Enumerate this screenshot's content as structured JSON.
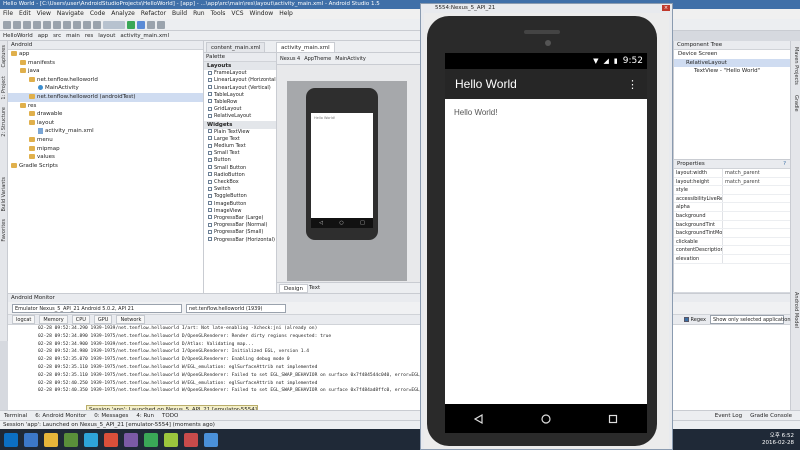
{
  "window": {
    "title": "Hello World - [C:\\Users\\user\\AndroidStudioProjects\\HelloWorld] - [app] - ...\\app\\src\\main\\res\\layout\\activity_main.xml - Android Studio 1.5"
  },
  "menu": [
    "File",
    "Edit",
    "View",
    "Navigate",
    "Code",
    "Analyze",
    "Refactor",
    "Build",
    "Run",
    "Tools",
    "VCS",
    "Window",
    "Help"
  ],
  "breadcrumbs": [
    "HelloWorld",
    "app",
    "src",
    "main",
    "res",
    "layout",
    "activity_main.xml"
  ],
  "left_strip": [
    "1: Project",
    "2: Structure",
    "Captures",
    "Build Variants",
    "Favorites"
  ],
  "project": {
    "selector": "Android",
    "tree": [
      {
        "label": "app",
        "kind": "folder",
        "indent": 0
      },
      {
        "label": "manifests",
        "kind": "folder",
        "indent": 1
      },
      {
        "label": "java",
        "kind": "folder",
        "indent": 1
      },
      {
        "label": "net.tenflow.helloworld",
        "kind": "folder",
        "indent": 2
      },
      {
        "label": "MainActivity",
        "kind": "class",
        "indent": 3
      },
      {
        "label": "net.tenflow.helloworld (androidTest)",
        "kind": "folder",
        "indent": 2
      },
      {
        "label": "res",
        "kind": "folder",
        "indent": 1
      },
      {
        "label": "drawable",
        "kind": "folder",
        "indent": 2
      },
      {
        "label": "layout",
        "kind": "folder",
        "indent": 2
      },
      {
        "label": "activity_main.xml",
        "kind": "file",
        "indent": 3
      },
      {
        "label": "menu",
        "kind": "folder",
        "indent": 2
      },
      {
        "label": "mipmap",
        "kind": "folder",
        "indent": 2
      },
      {
        "label": "values",
        "kind": "folder",
        "indent": 2
      },
      {
        "label": "Gradle Scripts",
        "kind": "folder",
        "indent": 0
      }
    ],
    "selected_index": 5
  },
  "editor_tabs": [
    "content_main.xml",
    "activity_main.xml"
  ],
  "palette": {
    "title": "Palette",
    "sections": [
      {
        "name": "Layouts",
        "items": [
          "FrameLayout",
          "LinearLayout (Horizontal)",
          "LinearLayout (Vertical)",
          "TableLayout",
          "TableRow",
          "GridLayout",
          "RelativeLayout"
        ]
      },
      {
        "name": "Widgets",
        "items": [
          "Plain TextView",
          "Large Text",
          "Medium Text",
          "Small Text",
          "Button",
          "Small Button",
          "RadioButton",
          "CheckBox",
          "Switch",
          "ToggleButton",
          "ImageButton",
          "ImageView",
          "ProgressBar (Large)",
          "ProgressBar (Normal)",
          "ProgressBar (Small)",
          "ProgressBar (Horizontal)"
        ]
      }
    ]
  },
  "designer": {
    "toolbar": [
      "Nexus 4",
      "AppTheme",
      "MainActivity"
    ],
    "preview_text": "Hello World!",
    "tabs": [
      "Design",
      "Text"
    ],
    "active_tab": "Design"
  },
  "emulator": {
    "title": "5554:Nexus_5_API_21",
    "time": "9:52",
    "app_title": "Hello World",
    "content": "Hello World!"
  },
  "component_tree": {
    "title": "Component Tree",
    "items": [
      "Device Screen",
      "RelativeLayout",
      "TextView - \"Hello World\""
    ]
  },
  "properties": {
    "title": "Properties",
    "rows": [
      {
        "k": "layout:width",
        "v": "match_parent"
      },
      {
        "k": "layout:height",
        "v": "match_parent"
      },
      {
        "k": "style",
        "v": ""
      },
      {
        "k": "accessibilityLiveRegion",
        "v": ""
      },
      {
        "k": "alpha",
        "v": ""
      },
      {
        "k": "background",
        "v": ""
      },
      {
        "k": "backgroundTint",
        "v": ""
      },
      {
        "k": "backgroundTintMode",
        "v": ""
      },
      {
        "k": "clickable",
        "v": ""
      },
      {
        "k": "contentDescription",
        "v": ""
      },
      {
        "k": "elevation",
        "v": ""
      }
    ]
  },
  "right_strip": [
    "Maven Projects",
    "Gradle",
    "Android Model"
  ],
  "monitor": {
    "title": "Android Monitor",
    "device": "Emulator Nexus_5_API_21  Android 5.0.2, API 21",
    "process": "net.tenflow.helloworld (1939)",
    "tabs": [
      "logcat",
      "Memory",
      "CPU",
      "GPU",
      "Network"
    ],
    "regex_label": "Regex",
    "filter": "Show only selected application",
    "log_lines": [
      "02-28 09:52:34.290 1939-1939/net.tenflow.helloworld I/art: Not late-enabling -Xcheck:jni (already on)",
      "02-28 09:52:34.890 1939-1975/net.tenflow.helloworld D/OpenGLRenderer: Render dirty regions requested: true",
      "02-28 09:52:34.900 1939-1939/net.tenflow.helloworld D/Atlas: Validating map...",
      "02-28 09:52:34.980 1939-1975/net.tenflow.helloworld I/OpenGLRenderer: Initialized EGL, version 1.4",
      "02-28 09:52:35.070 1939-1975/net.tenflow.helloworld D/OpenGLRenderer: Enabling debug mode 0",
      "02-28 09:52:35.110 1939-1975/net.tenflow.helloworld W/EGL_emulation: eglSurfaceAttrib not implemented",
      "02-28 09:52:35.110 1939-1975/net.tenflow.helloworld W/OpenGLRenderer: Failed to set EGL_SWAP_BEHAVIOR on surface 0x7f484544c040, error=EGL_SUCCESS",
      "02-28 09:52:40.250 1939-1975/net.tenflow.helloworld W/EGL_emulation: eglSurfaceAttrib not implemented",
      "02-28 09:52:40.350 1939-1975/net.tenflow.helloworld W/OpenGLRenderer: Failed to set EGL_SWAP_BEHAVIOR on surface 0x7f484ad8ffc0, error=EGL_SUCCESS"
    ]
  },
  "tooltip": "Session 'app': Launched on Nexus_5_API_21 [emulator-5554]",
  "tool_windows": [
    "Terminal",
    "6: Android Monitor",
    "0: Messages",
    "4: Run",
    "TODO",
    "Event Log",
    "Gradle Console"
  ],
  "status": "Session 'app': Launched on Nexus_5_API_21 [emulator-5554] (moments ago)",
  "clock": {
    "time": "오후 6:52",
    "date": "2016-02-28"
  }
}
